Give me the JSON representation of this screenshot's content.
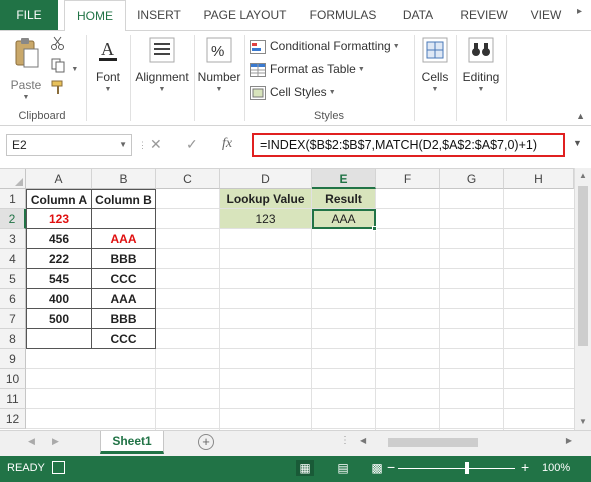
{
  "ribbon_tabs": [
    {
      "label": "FILE"
    },
    {
      "label": "HOME"
    },
    {
      "label": "INSERT"
    },
    {
      "label": "PAGE LAYOUT"
    },
    {
      "label": "FORMULAS"
    },
    {
      "label": "DATA"
    },
    {
      "label": "REVIEW"
    },
    {
      "label": "VIEW"
    }
  ],
  "ribbon": {
    "clipboard": {
      "paste": "Paste",
      "group_label": "Clipboard"
    },
    "font": {
      "label": "Font"
    },
    "alignment": {
      "label": "Alignment"
    },
    "number": {
      "label": "Number"
    },
    "styles": {
      "conditional_formatting": "Conditional Formatting",
      "format_as_table": "Format as Table",
      "cell_styles": "Cell Styles",
      "group_label": "Styles"
    },
    "cells": {
      "label": "Cells"
    },
    "editing": {
      "label": "Editing"
    }
  },
  "formula_bar": {
    "name_box": "E2",
    "formula": "=INDEX($B$2:$B$7,MATCH(D2,$A$2:$A$7,0)+1)"
  },
  "columns": [
    "A",
    "B",
    "C",
    "D",
    "E",
    "F",
    "G",
    "H"
  ],
  "rows": [
    "1",
    "2",
    "3",
    "4",
    "5",
    "6",
    "7",
    "8",
    "9",
    "10",
    "11",
    "12"
  ],
  "cells": {
    "A1": "Column A",
    "B1": "Column B",
    "A2": "123",
    "A3": "456",
    "B3": "AAA",
    "A4": "222",
    "B4": "BBB",
    "A5": "545",
    "B5": "CCC",
    "A6": "400",
    "B6": "AAA",
    "A7": "500",
    "B7": "BBB",
    "B8": "CCC",
    "D1": "Lookup Value",
    "E1": "Result",
    "D2": "123",
    "E2": "AAA"
  },
  "sheet_tab": "Sheet1",
  "status": {
    "ready": "READY",
    "zoom": "100%"
  }
}
